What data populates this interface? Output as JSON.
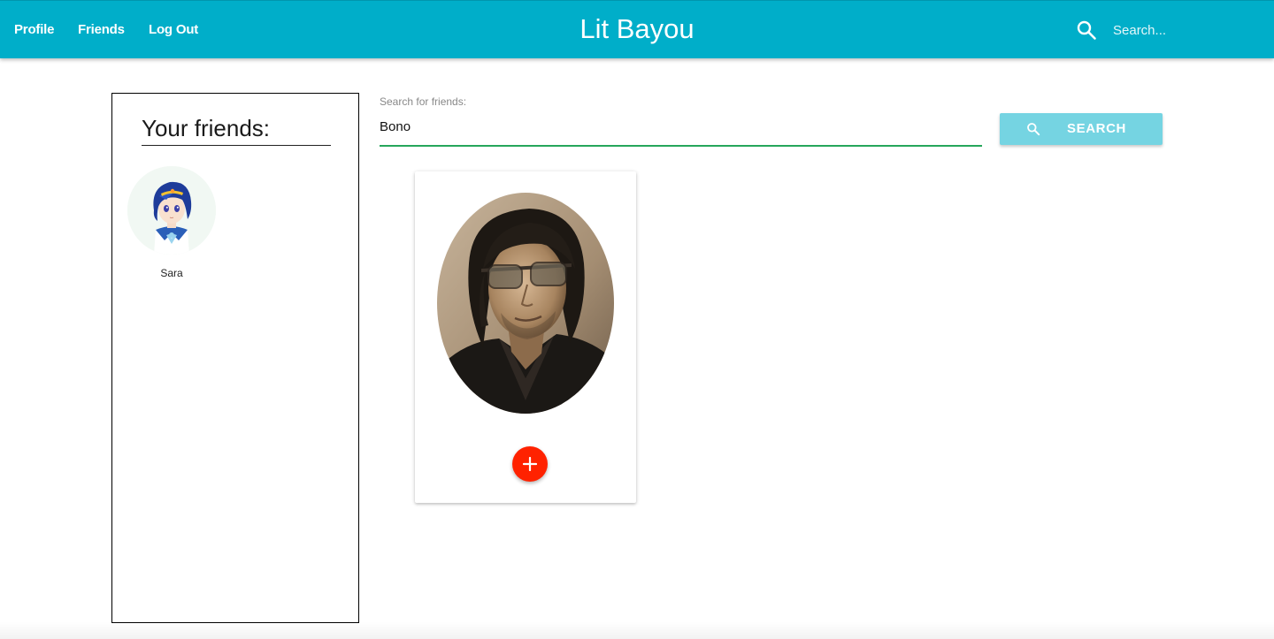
{
  "navbar": {
    "brand": "Lit Bayou",
    "links": [
      {
        "label": "Profile"
      },
      {
        "label": "Friends"
      },
      {
        "label": "Log Out"
      }
    ],
    "search_placeholder": "Search...",
    "search_icon": "search-icon"
  },
  "friends_panel": {
    "title": "Your friends:",
    "friends": [
      {
        "name": "Sara",
        "avatar": "anime-avatar"
      }
    ]
  },
  "search": {
    "label": "Search for friends:",
    "value": "Bono",
    "button_label": "SEARCH",
    "button_icon": "search-icon"
  },
  "results": [
    {
      "photo": "person-photo",
      "action_icon": "plus-icon"
    }
  ],
  "colors": {
    "navbar": "#00aec9",
    "search_button": "#75d4e2",
    "input_underline": "#26a65b",
    "add_button": "#ff2200"
  }
}
